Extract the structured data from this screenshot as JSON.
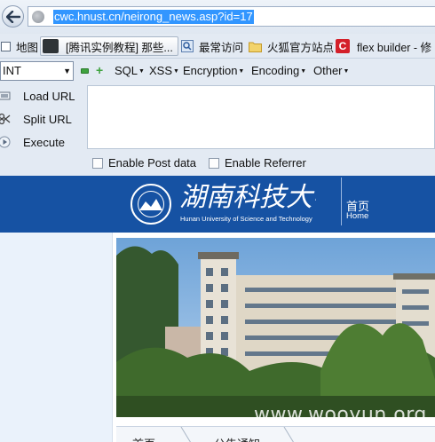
{
  "browser": {
    "url": "cwc.hnust.cn/neirong_news.asp?id=17"
  },
  "bookmarks": [
    {
      "label": "地图",
      "icon": "checkbox-icon"
    },
    {
      "label": "[腾讯实例教程] 那些...",
      "icon": "tab-thumbnail-icon"
    },
    {
      "label": "最常访问",
      "icon": "magnifier-bookmark-icon"
    },
    {
      "label": "火狐官方站点",
      "icon": "folder-icon"
    },
    {
      "label": "flex builder - 修",
      "icon": "red-c-icon"
    }
  ],
  "hackbar": {
    "mode": "INT",
    "menus": [
      "SQL",
      "XSS",
      "Encryption",
      "Encoding",
      "Other"
    ],
    "load_url": "Load URL",
    "split_url": "Split URL",
    "execute": "Execute",
    "textarea_value": "",
    "enable_post": "Enable Post data",
    "enable_referrer": "Enable Referrer"
  },
  "site": {
    "name_cn": "湖南科技大学",
    "name_en": "Hunan University of Science and Technology",
    "nav_home_cn": "首页",
    "nav_home_en": "Home",
    "bottom_tabs": [
      "首页",
      "公告通知"
    ],
    "watermark": "www.wooyun.org"
  },
  "colors": {
    "header_blue": "#1652a3",
    "url_highlight": "#3296ff"
  }
}
